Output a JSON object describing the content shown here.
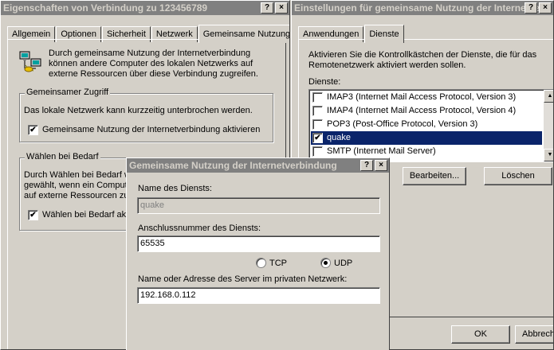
{
  "left_window": {
    "title": "Eigenschaften von Verbindung zu 123456789",
    "help_btn": "?",
    "close_btn": "×",
    "tabs": [
      "Allgemein",
      "Optionen",
      "Sicherheit",
      "Netzwerk",
      "Gemeinsame Nutzung"
    ],
    "intro_lines": [
      "Durch gemeinsame Nutzung der Internetverbindung",
      "können andere Computer des lokalen Netzwerks auf",
      "externe Ressourcen über diese Verbindung zugreifen."
    ],
    "group_access": {
      "label": "Gemeinsamer Zugriff",
      "warning": "Das lokale Netzwerk kann kurzzeitig unterbrochen werden.",
      "checkbox_label": "Gemeinsame Nutzung der Internetverbindung aktivieren",
      "checked": true
    },
    "group_dial": {
      "label": "Wählen bei Bedarf",
      "lines": [
        "Durch Wählen bei Bedarf w",
        "gewählt, wenn ein Comput",
        "auf externe Ressourcen zu"
      ],
      "checkbox_label": "Wählen bei Bedarf akt",
      "checked": true
    }
  },
  "right_window": {
    "title": "Einstellungen für gemeinsame Nutzung der Internetver...",
    "help_btn": "?",
    "close_btn": "×",
    "tabs": [
      "Anwendungen",
      "Dienste"
    ],
    "intro_lines": [
      "Aktivieren Sie die Kontrollkästchen der Dienste, die für das",
      "Remotenetzwerk aktiviert werden sollen."
    ],
    "services_label": "Dienste:",
    "services": [
      {
        "label": "IMAP3 (Internet Mail Access Protocol, Version 3)",
        "checked": false,
        "selected": false
      },
      {
        "label": "IMAP4 (Internet Mail Access Protocol, Version 4)",
        "checked": false,
        "selected": false
      },
      {
        "label": "POP3 (Post-Office Protocol, Version 3)",
        "checked": false,
        "selected": false
      },
      {
        "label": "quake",
        "checked": true,
        "selected": true
      },
      {
        "label": "SMTP (Internet Mail Server)",
        "checked": false,
        "selected": false
      }
    ],
    "edit_button": "Bearbeiten...",
    "delete_button": "Löschen",
    "ok_button": "OK",
    "cancel_button": "Abbrech"
  },
  "dialog": {
    "title": "Gemeinsame Nutzung der Internetverbindung",
    "help_btn": "?",
    "close_btn": "×",
    "service_name_label": "Name des Diensts:",
    "service_name_value": "quake",
    "port_label": "Anschlussnummer des Diensts:",
    "port_value": "65535",
    "tcp_label": "TCP",
    "udp_label": "UDP",
    "protocol_selected": "UDP",
    "server_label": "Name oder Adresse des Server im privaten Netzwerk:",
    "server_value": "192.168.0.112"
  }
}
